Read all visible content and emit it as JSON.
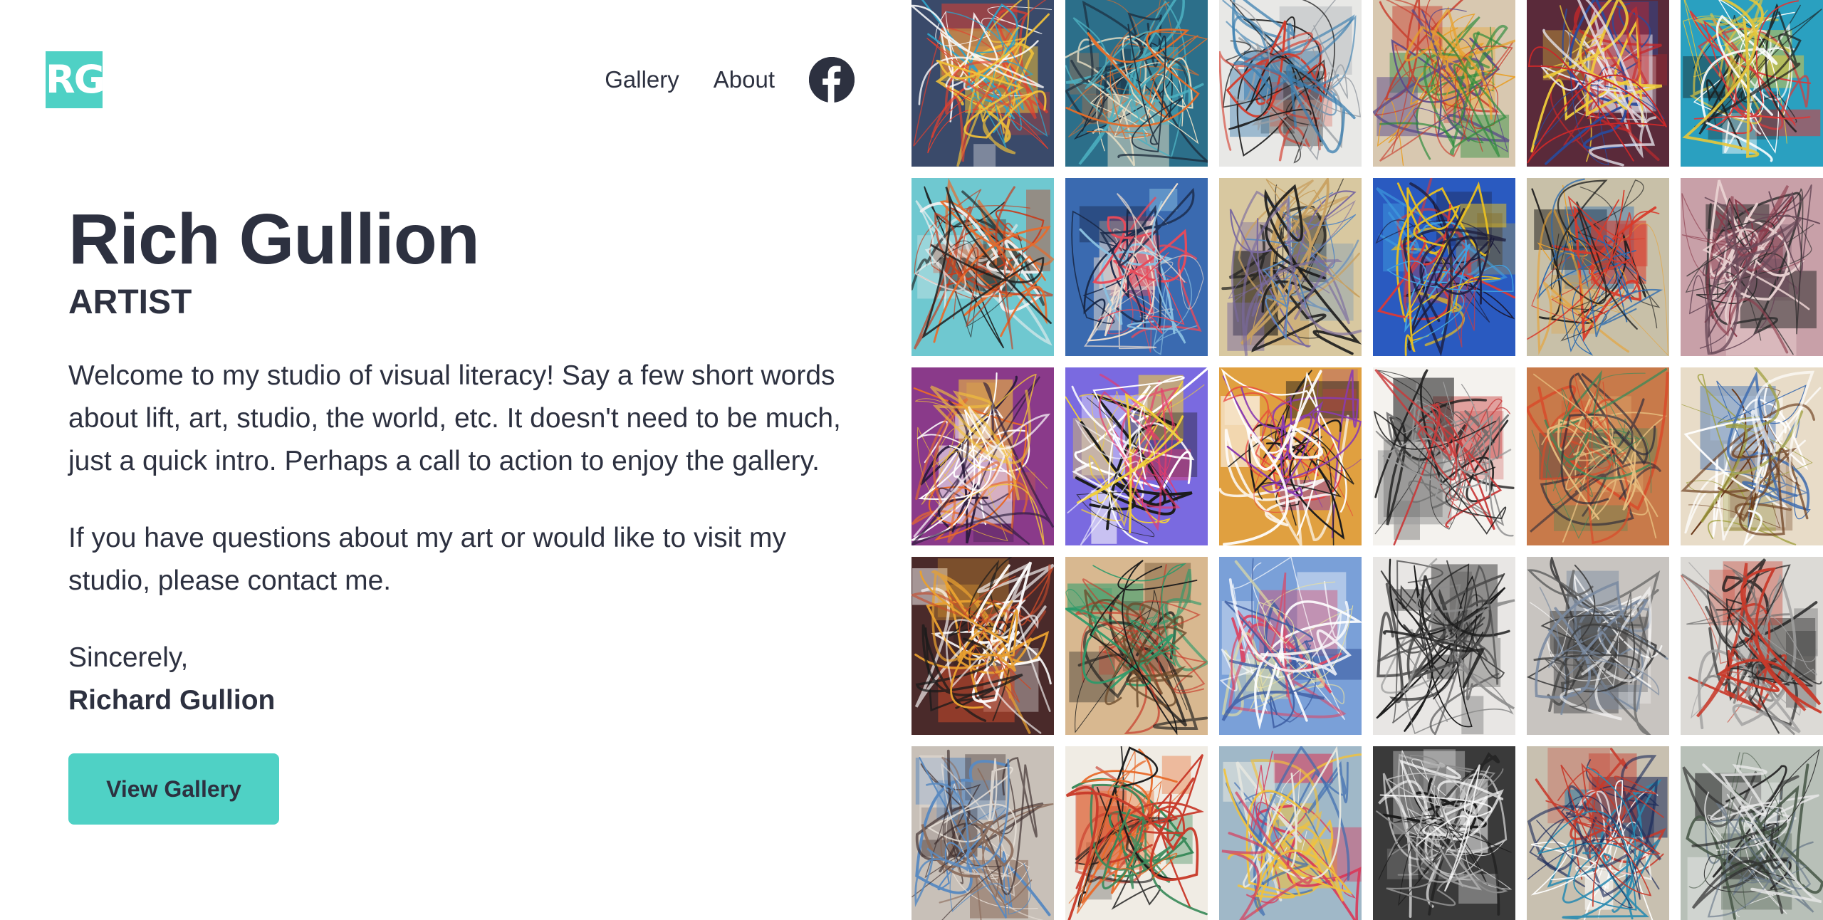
{
  "logo": {
    "text": "RG"
  },
  "nav": {
    "links": [
      {
        "label": "Gallery"
      },
      {
        "label": "About"
      }
    ],
    "social_icon": "facebook-icon"
  },
  "hero": {
    "name": "Rich Gullion",
    "role": "ARTIST",
    "paragraphs": [
      "Welcome to my studio of visual literacy! Say a few short words about lift, art, studio, the world, etc. It doesn't need to be much, just a quick intro. Perhaps a call to action to enjoy the gallery.",
      "If you have questions about my art or would like to visit my studio, please contact me."
    ],
    "closing": "Sincerely,",
    "signature": "Richard Gullion",
    "cta_label": "View Gallery"
  },
  "colors": {
    "accent": "#4fd1c5",
    "text": "#2d3140"
  },
  "gallery": {
    "tiles": [
      {
        "bg": "#3a4a6a",
        "c": [
          "#e4402e",
          "#f2c23a",
          "#2fa3c8",
          "#ffffff"
        ]
      },
      {
        "bg": "#2c6f8a",
        "c": [
          "#e46d2a",
          "#1b2a3a",
          "#f0e4c8",
          "#4cb0c0"
        ]
      },
      {
        "bg": "#e8e8e6",
        "c": [
          "#1b1b1b",
          "#3a7eb0",
          "#d43a2a",
          "#9aa0a6"
        ]
      },
      {
        "bg": "#d8c8b0",
        "c": [
          "#c83a2a",
          "#2a8a3a",
          "#e8a02a",
          "#5a4a8a"
        ]
      },
      {
        "bg": "#5a2a3a",
        "c": [
          "#e8e8f0",
          "#c8282a",
          "#2a4a9a",
          "#f2d03a"
        ]
      },
      {
        "bg": "#2aa0c0",
        "c": [
          "#1b1b1b",
          "#e8c83a",
          "#d83a3a",
          "#ffffff"
        ]
      },
      {
        "bg": "#6fc8d0",
        "c": [
          "#c83a1a",
          "#1b1b1b",
          "#f0f0f0",
          "#e86a2a"
        ]
      },
      {
        "bg": "#3a6ab0",
        "c": [
          "#e84a5a",
          "#f0e0d0",
          "#1a2a4a",
          "#8ac0e0"
        ]
      },
      {
        "bg": "#d8c8a0",
        "c": [
          "#1b1b1b",
          "#7a6aa0",
          "#c8a060",
          "#5a8ac0"
        ]
      },
      {
        "bg": "#2a5ac0",
        "c": [
          "#1b1b3a",
          "#e8c020",
          "#d83a3a",
          "#40a0e0"
        ]
      },
      {
        "bg": "#c8c0a8",
        "c": [
          "#1b1b1b",
          "#d83a2a",
          "#2a6ab0",
          "#e8a030"
        ]
      },
      {
        "bg": "#c8a0a8",
        "c": [
          "#2a2a2a",
          "#6a4a5a",
          "#e8d0d0",
          "#8a3a4a"
        ]
      },
      {
        "bg": "#8a3a8a",
        "c": [
          "#f2c23a",
          "#ffffff",
          "#e86a2a",
          "#2a1a3a"
        ]
      },
      {
        "bg": "#7a6ae0",
        "c": [
          "#f2d03a",
          "#ffffff",
          "#1b1b1b",
          "#e83a6a"
        ]
      },
      {
        "bg": "#e0a040",
        "c": [
          "#8a3ab0",
          "#ffffff",
          "#1b1b1b",
          "#e83a3a"
        ]
      },
      {
        "bg": "#f4f2ee",
        "c": [
          "#1b1b1b",
          "#c83a3a",
          "#9a9a9a",
          "#6a6a6a"
        ]
      },
      {
        "bg": "#c87a4a",
        "c": [
          "#3a8a5a",
          "#e8c080",
          "#2a2a3a",
          "#d84a2a"
        ]
      },
      {
        "bg": "#e8dcc8",
        "c": [
          "#6a3a1a",
          "#ffffff",
          "#3a6ab0",
          "#a0a040"
        ]
      },
      {
        "bg": "#4a2a2a",
        "c": [
          "#ffffff",
          "#e8a030",
          "#c84a2a",
          "#1b1b1b"
        ]
      },
      {
        "bg": "#d8b890",
        "c": [
          "#1b1b1b",
          "#2a9a6a",
          "#c83a2a",
          "#6a4a2a"
        ]
      },
      {
        "bg": "#7aa0d8",
        "c": [
          "#e8e0a0",
          "#ffffff",
          "#d84a6a",
          "#3a5aa0"
        ]
      },
      {
        "bg": "#e8e6e4",
        "c": [
          "#1b1b1b",
          "#4a4a4a",
          "#8a8a8a",
          "#2a2a2a"
        ]
      },
      {
        "bg": "#c8c4c0",
        "c": [
          "#3a3a3a",
          "#7a8aa0",
          "#ffffff",
          "#5a5a5a"
        ]
      },
      {
        "bg": "#dcdad6",
        "c": [
          "#1b1b1b",
          "#c83a2a",
          "#6a6a6a",
          "#a0a0a0"
        ]
      },
      {
        "bg": "#c8c0b8",
        "c": [
          "#3a2a2a",
          "#5a8ac0",
          "#e8e0d8",
          "#8a6a5a"
        ]
      },
      {
        "bg": "#f0ece4",
        "c": [
          "#c83a2a",
          "#e86a2a",
          "#1b1b1b",
          "#3a8a5a"
        ]
      },
      {
        "bg": "#a0b8c8",
        "c": [
          "#f2c23a",
          "#d83a5a",
          "#3a6ab0",
          "#e8e8e0"
        ]
      },
      {
        "bg": "#3a3a3a",
        "c": [
          "#ffffff",
          "#c8c8c8",
          "#1b1b1b",
          "#8a8a8a"
        ]
      },
      {
        "bg": "#c8c0b0",
        "c": [
          "#1b2a5a",
          "#c83a2a",
          "#ffffff",
          "#2a8ab0"
        ]
      },
      {
        "bg": "#b8c0b8",
        "c": [
          "#2a2a2a",
          "#e8e8e8",
          "#6a7a8a",
          "#4a5a4a"
        ]
      }
    ]
  }
}
